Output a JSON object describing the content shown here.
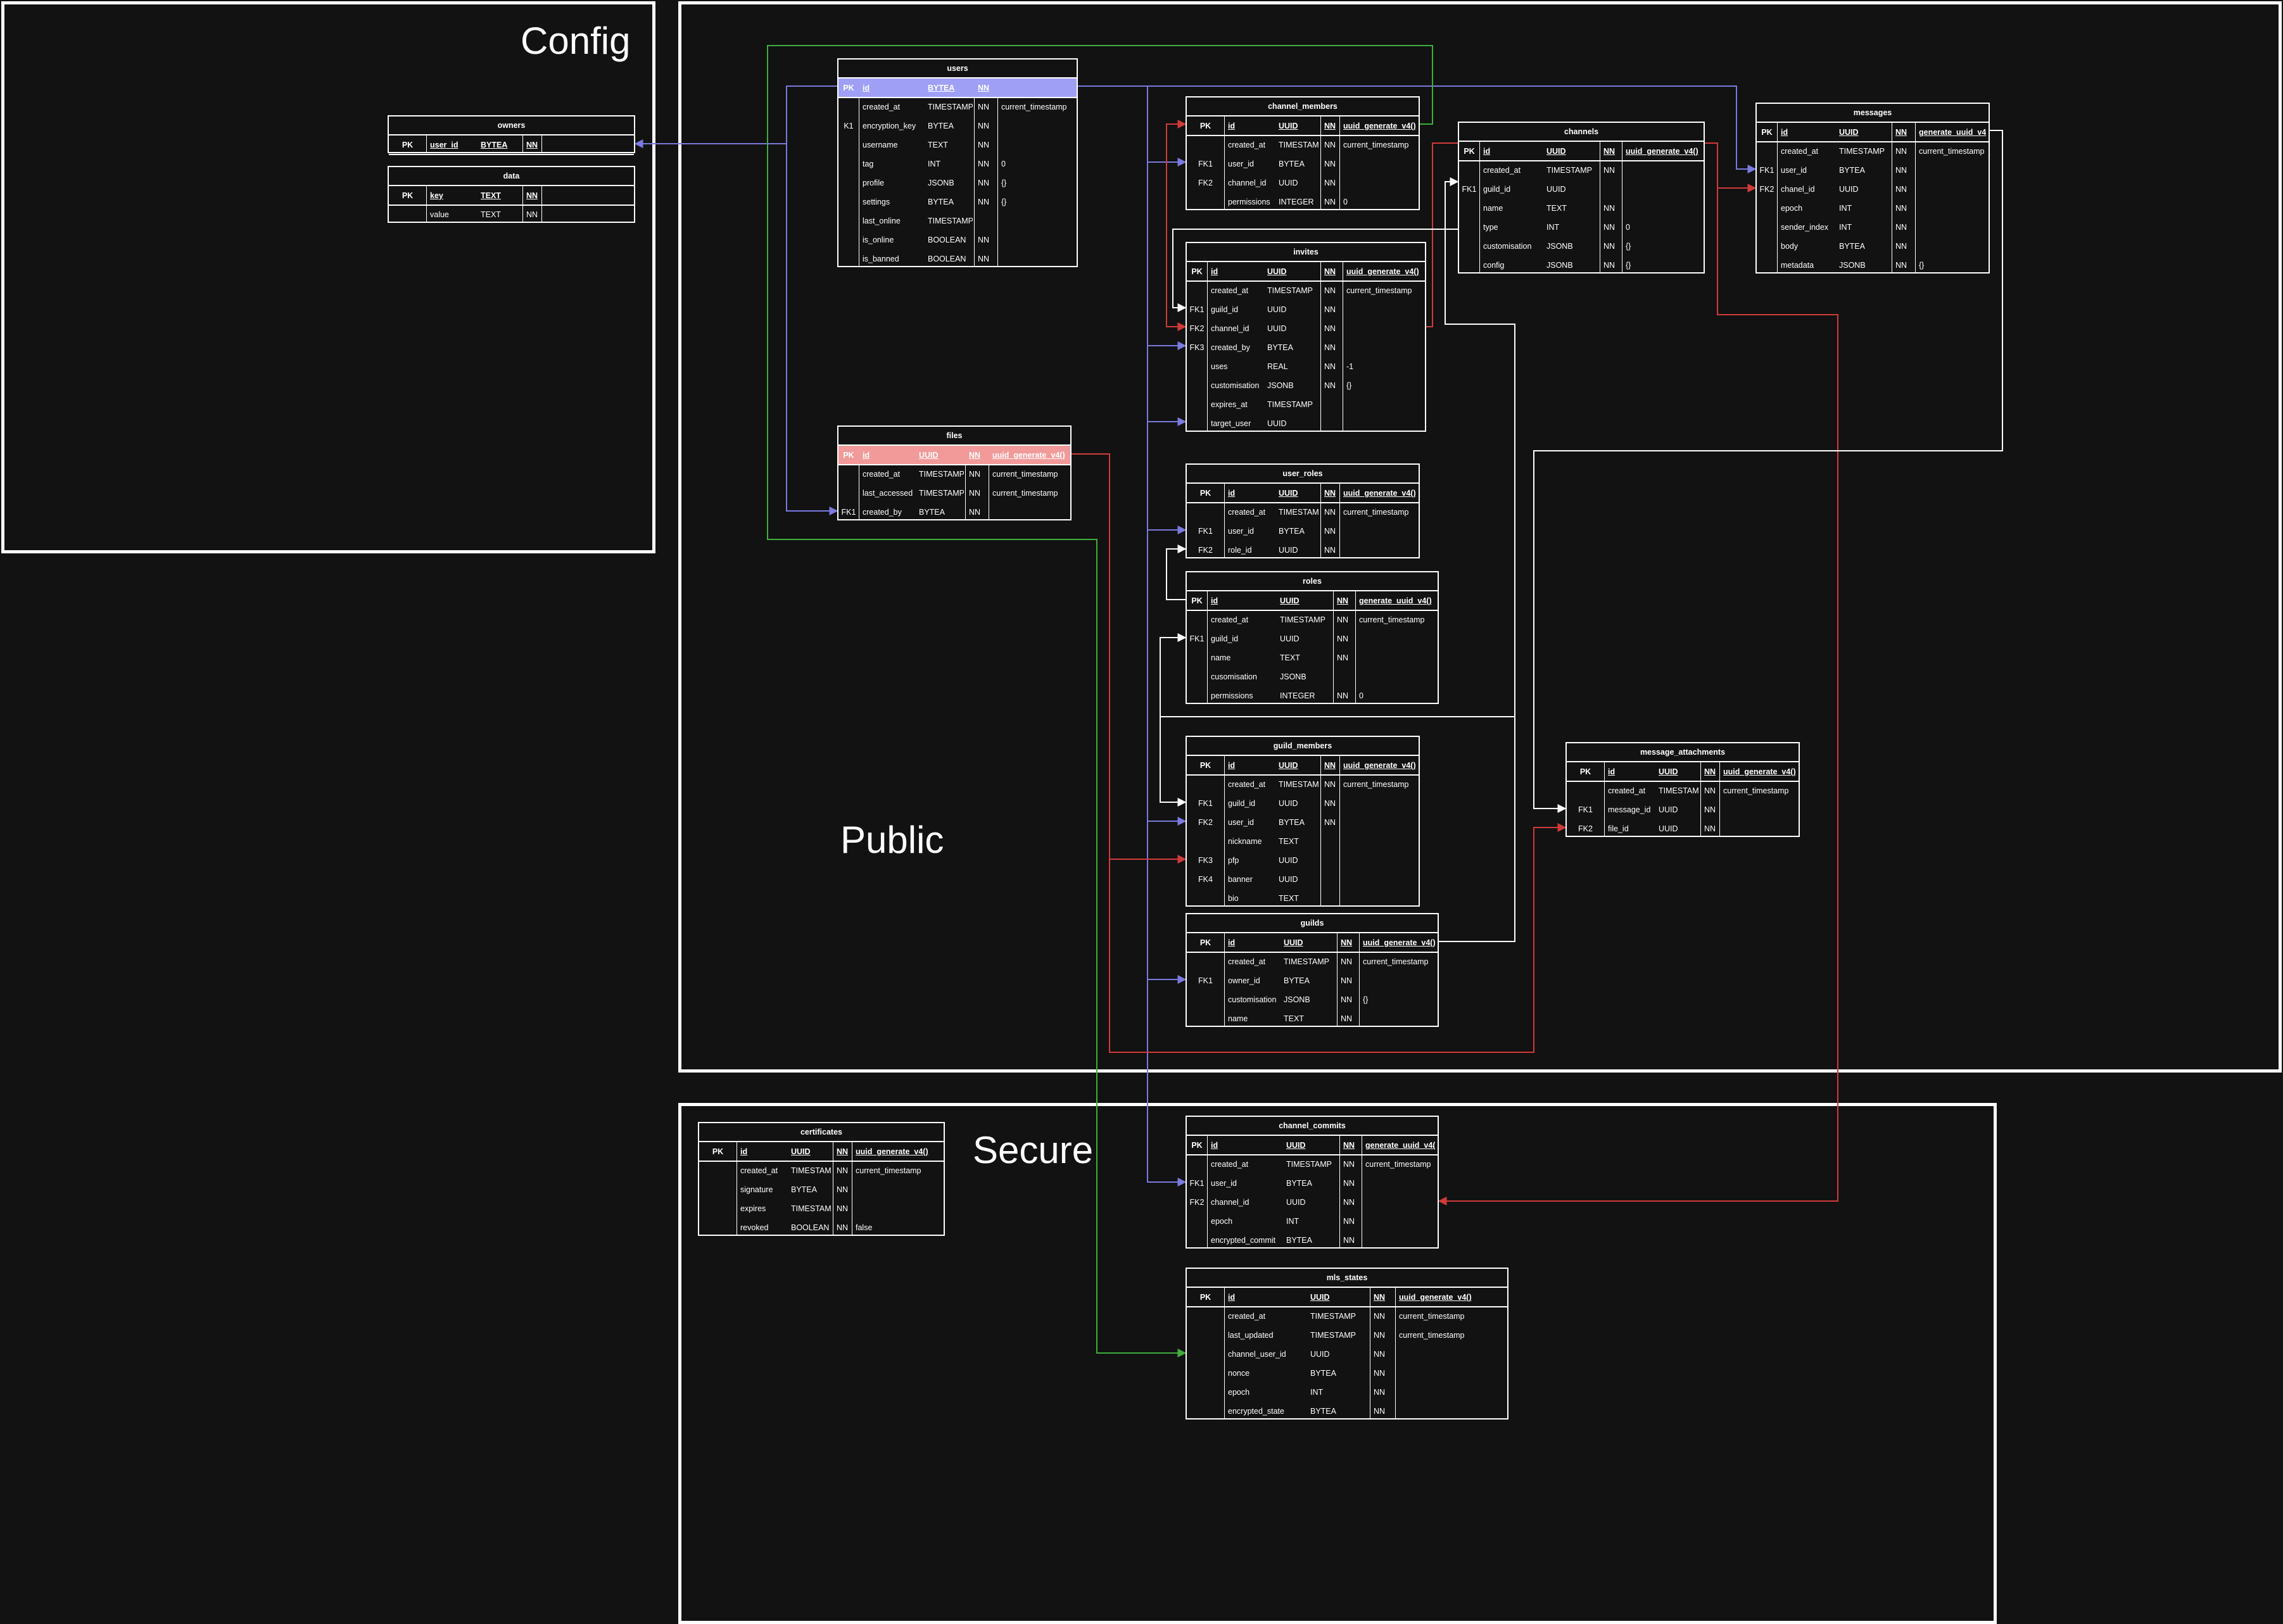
{
  "colors": {
    "background": "#121212",
    "foreground": "#ffffff",
    "users_header": "#9f9ff6",
    "files_header": "#f29a9a",
    "edge_blue": "#7a7ae0",
    "edge_red": "#d23a3a",
    "edge_green": "#3fae3f",
    "edge_white": "#ffffff"
  },
  "schemas": {
    "config": "Config",
    "public": "Public",
    "secure": "Secure"
  },
  "tables": [
    {
      "id": "owners",
      "title": "owners",
      "rows": [
        [
          "PK",
          "user_id",
          "BYTEA",
          "NN",
          ""
        ]
      ]
    },
    {
      "id": "data",
      "title": "data",
      "rows": [
        [
          "PK",
          "key",
          "TEXT",
          "NN",
          ""
        ],
        [
          "",
          "value",
          "TEXT",
          "NN",
          ""
        ]
      ]
    },
    {
      "id": "users",
      "title": "users",
      "rows": [
        [
          "PK",
          "id",
          "BYTEA",
          "NN",
          ""
        ],
        [
          "",
          "created_at",
          "TIMESTAMP",
          "NN",
          "current_timestamp"
        ],
        [
          "K1",
          "encryption_key",
          "BYTEA",
          "NN",
          ""
        ],
        [
          "",
          "username",
          "TEXT",
          "NN",
          ""
        ],
        [
          "",
          "tag",
          "INT",
          "NN",
          "0"
        ],
        [
          "",
          "profile",
          "JSONB",
          "NN",
          "{}"
        ],
        [
          "",
          "settings",
          "BYTEA",
          "NN",
          "{}"
        ],
        [
          "",
          "last_online",
          "TIMESTAMP",
          "",
          ""
        ],
        [
          "",
          "is_online",
          "BOOLEAN",
          "NN",
          ""
        ],
        [
          "",
          "is_banned",
          "BOOLEAN",
          "NN",
          ""
        ]
      ]
    },
    {
      "id": "files",
      "title": "files",
      "rows": [
        [
          "PK",
          "id",
          "UUID",
          "NN",
          "uuid_generate_v4()"
        ],
        [
          "",
          "created_at",
          "TIMESTAMP",
          "NN",
          "current_timestamp"
        ],
        [
          "",
          "last_accessed",
          "TIMESTAMP",
          "NN",
          "current_timestamp"
        ],
        [
          "FK1",
          "created_by",
          "BYTEA",
          "NN",
          ""
        ]
      ]
    },
    {
      "id": "channel_members",
      "title": "channel_members",
      "rows": [
        [
          "PK",
          "id",
          "UUID",
          "NN",
          "uuid_generate_v4()"
        ],
        [
          "",
          "created_at",
          "TIMESTAMP",
          "NN",
          "current_timestamp"
        ],
        [
          "FK1",
          "user_id",
          "BYTEA",
          "NN",
          ""
        ],
        [
          "FK2",
          "channel_id",
          "UUID",
          "NN",
          ""
        ],
        [
          "",
          "permissions",
          "INTEGER",
          "NN",
          "0"
        ]
      ]
    },
    {
      "id": "channels",
      "title": "channels",
      "rows": [
        [
          "PK",
          "id",
          "UUID",
          "NN",
          "uuid_generate_v4()"
        ],
        [
          "",
          "created_at",
          "TIMESTAMP",
          "NN",
          ""
        ],
        [
          "FK1",
          "guild_id",
          "UUID",
          "",
          ""
        ],
        [
          "",
          "name",
          "TEXT",
          "NN",
          ""
        ],
        [
          "",
          "type",
          "INT",
          "NN",
          "0"
        ],
        [
          "",
          "customisation",
          "JSONB",
          "NN",
          "{}"
        ],
        [
          "",
          "config",
          "JSONB",
          "NN",
          "{}"
        ]
      ]
    },
    {
      "id": "messages",
      "title": "messages",
      "rows": [
        [
          "PK",
          "id",
          "UUID",
          "NN",
          "generate_uuid_v4()"
        ],
        [
          "",
          "created_at",
          "TIMESTAMP",
          "NN",
          "current_timestamp"
        ],
        [
          "FK1",
          "user_id",
          "BYTEA",
          "NN",
          ""
        ],
        [
          "FK2",
          "chanel_id",
          "UUID",
          "NN",
          ""
        ],
        [
          "",
          "epoch",
          "INT",
          "NN",
          ""
        ],
        [
          "",
          "sender_index",
          "INT",
          "NN",
          ""
        ],
        [
          "",
          "body",
          "BYTEA",
          "NN",
          ""
        ],
        [
          "",
          "metadata",
          "JSONB",
          "NN",
          "{}"
        ]
      ]
    },
    {
      "id": "invites",
      "title": "invites",
      "rows": [
        [
          "PK",
          "id",
          "UUID",
          "NN",
          "uuid_generate_v4()"
        ],
        [
          "",
          "created_at",
          "TIMESTAMP",
          "NN",
          "current_timestamp"
        ],
        [
          "FK1",
          "guild_id",
          "UUID",
          "NN",
          ""
        ],
        [
          "FK2",
          "channel_id",
          "UUID",
          "NN",
          ""
        ],
        [
          "FK3",
          "created_by",
          "BYTEA",
          "NN",
          ""
        ],
        [
          "",
          "uses",
          "REAL",
          "NN",
          "-1"
        ],
        [
          "",
          "customisation",
          "JSONB",
          "NN",
          "{}"
        ],
        [
          "",
          "expires_at",
          "TIMESTAMP",
          "",
          ""
        ],
        [
          "",
          "target_user",
          "UUID",
          "",
          ""
        ]
      ]
    },
    {
      "id": "user_roles",
      "title": "user_roles",
      "rows": [
        [
          "PK",
          "id",
          "UUID",
          "NN",
          "uuid_generate_v4()"
        ],
        [
          "",
          "created_at",
          "TIMESTAMP",
          "NN",
          "current_timestamp"
        ],
        [
          "FK1",
          "user_id",
          "BYTEA",
          "NN",
          ""
        ],
        [
          "FK2",
          "role_id",
          "UUID",
          "NN",
          ""
        ]
      ]
    },
    {
      "id": "roles",
      "title": "roles",
      "rows": [
        [
          "PK",
          "id",
          "UUID",
          "NN",
          "generate_uuid_v4()"
        ],
        [
          "",
          "created_at",
          "TIMESTAMP",
          "NN",
          "current_timestamp"
        ],
        [
          "FK1",
          "guild_id",
          "UUID",
          "NN",
          ""
        ],
        [
          "",
          "name",
          "TEXT",
          "NN",
          ""
        ],
        [
          "",
          "cusomisation",
          "JSONB",
          "",
          ""
        ],
        [
          "",
          "permissions",
          "INTEGER",
          "NN",
          "0"
        ]
      ]
    },
    {
      "id": "guild_members",
      "title": "guild_members",
      "rows": [
        [
          "PK",
          "id",
          "UUID",
          "NN",
          "uuid_generate_v4()"
        ],
        [
          "",
          "created_at",
          "TIMESTAMP",
          "NN",
          "current_timestamp"
        ],
        [
          "FK1",
          "guild_id",
          "UUID",
          "NN",
          ""
        ],
        [
          "FK2",
          "user_id",
          "BYTEA",
          "NN",
          ""
        ],
        [
          "",
          "nickname",
          "TEXT",
          "",
          ""
        ],
        [
          "FK3",
          "pfp",
          "UUID",
          "",
          ""
        ],
        [
          "FK4",
          "banner",
          "UUID",
          "",
          ""
        ],
        [
          "",
          "bio",
          "TEXT",
          "",
          ""
        ]
      ]
    },
    {
      "id": "guilds",
      "title": "guilds",
      "rows": [
        [
          "PK",
          "id",
          "UUID",
          "NN",
          "uuid_generate_v4()"
        ],
        [
          "",
          "created_at",
          "TIMESTAMP",
          "NN",
          "current_timestamp"
        ],
        [
          "FK1",
          "owner_id",
          "BYTEA",
          "NN",
          ""
        ],
        [
          "",
          "customisation",
          "JSONB",
          "NN",
          "{}"
        ],
        [
          "",
          "name",
          "TEXT",
          "NN",
          ""
        ]
      ]
    },
    {
      "id": "message_attachments",
      "title": "message_attachments",
      "rows": [
        [
          "PK",
          "id",
          "UUID",
          "NN",
          "uuid_generate_v4()"
        ],
        [
          "",
          "created_at",
          "TIMESTAMP",
          "NN",
          "current_timestamp"
        ],
        [
          "FK1",
          "message_id",
          "UUID",
          "NN",
          ""
        ],
        [
          "FK2",
          "file_id",
          "UUID",
          "NN",
          ""
        ]
      ]
    },
    {
      "id": "certificates",
      "title": "certificates",
      "rows": [
        [
          "PK",
          "id",
          "UUID",
          "NN",
          "uuid_generate_v4()"
        ],
        [
          "",
          "created_at",
          "TIMESTAMP",
          "NN",
          "current_timestamp"
        ],
        [
          "",
          "signature",
          "BYTEA",
          "NN",
          ""
        ],
        [
          "",
          "expires",
          "TIMESTAMP",
          "NN",
          ""
        ],
        [
          "",
          "revoked",
          "BOOLEAN",
          "NN",
          "false"
        ]
      ]
    },
    {
      "id": "channel_commits",
      "title": "channel_commits",
      "rows": [
        [
          "PK",
          "id",
          "UUID",
          "NN",
          "generate_uuid_v4()"
        ],
        [
          "",
          "created_at",
          "TIMESTAMP",
          "NN",
          "current_timestamp"
        ],
        [
          "FK1",
          "user_id",
          "BYTEA",
          "NN",
          ""
        ],
        [
          "FK2",
          "channel_id",
          "UUID",
          "NN",
          ""
        ],
        [
          "",
          "epoch",
          "INT",
          "NN",
          ""
        ],
        [
          "",
          "encrypted_commit",
          "BYTEA",
          "NN",
          ""
        ]
      ]
    },
    {
      "id": "mls_states",
      "title": "mls_states",
      "rows": [
        [
          "PK",
          "id",
          "UUID",
          "NN",
          "uuid_generate_v4()"
        ],
        [
          "",
          "created_at",
          "TIMESTAMP",
          "NN",
          "current_timestamp"
        ],
        [
          "",
          "last_updated",
          "TIMESTAMP",
          "NN",
          "current_timestamp"
        ],
        [
          "",
          "channel_user_id",
          "UUID",
          "NN",
          ""
        ],
        [
          "",
          "nonce",
          "BYTEA",
          "NN",
          ""
        ],
        [
          "",
          "epoch",
          "INT",
          "NN",
          ""
        ],
        [
          "",
          "encrypted_state",
          "BYTEA",
          "NN",
          ""
        ]
      ]
    }
  ]
}
